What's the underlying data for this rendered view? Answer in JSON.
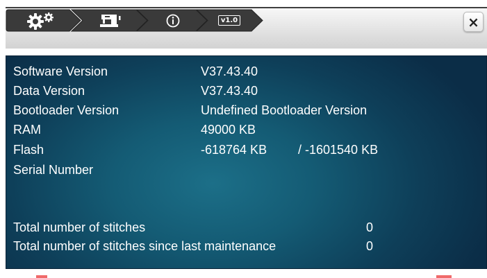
{
  "breadcrumb": {
    "items": [
      {
        "icon": "gears-icon"
      },
      {
        "icon": "sewing-machine-icon"
      },
      {
        "icon": "info-icon"
      },
      {
        "icon": "version-badge-icon",
        "text": "v1.0"
      }
    ]
  },
  "close_button": {
    "icon": "close-icon",
    "label": "×"
  },
  "info": {
    "software_version_label": "Software Version",
    "software_version_value": "V37.43.40",
    "data_version_label": "Data Version",
    "data_version_value": "V37.43.40",
    "bootloader_version_label": "Bootloader Version",
    "bootloader_version_value": "Undefined Bootloader Version",
    "ram_label": "RAM",
    "ram_value": "49000 KB",
    "flash_label": "Flash",
    "flash_value": "-618764 KB",
    "flash_total": "/ -1601540 KB",
    "serial_number_label": "Serial Number",
    "serial_number_value": ""
  },
  "stitches": {
    "total_label": "Total number of stitches",
    "total_value": "0",
    "since_maintenance_label": "Total number of stitches since last maintenance",
    "since_maintenance_value": "0"
  },
  "colors": {
    "crumb_dark": "#3a3a3a",
    "panel_center": "#1c6f88",
    "panel_edge": "#0b2d47",
    "text": "#ffffff"
  }
}
